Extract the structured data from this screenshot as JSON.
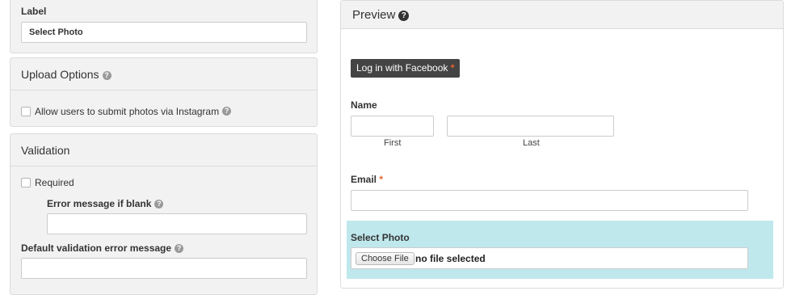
{
  "left": {
    "label_panel": {
      "label": "Label",
      "value": "Select Photo"
    },
    "upload_panel": {
      "title": "Upload Options",
      "instagram_checkbox_label": "Allow users to submit photos via Instagram",
      "instagram_checked": false
    },
    "validation_panel": {
      "title": "Validation",
      "required_label": "Required",
      "required_checked": false,
      "error_blank_label": "Error message if blank",
      "error_blank_value": "",
      "default_error_label": "Default validation error message",
      "default_error_value": ""
    }
  },
  "preview": {
    "title": "Preview",
    "facebook_button": "Log in with Facebook",
    "required_marker": "*",
    "name_label": "Name",
    "first_sublabel": "First",
    "last_sublabel": "Last",
    "email_label": "Email",
    "photo_label": "Select Photo",
    "choose_file_button": "Choose File",
    "file_status": "no file selected"
  },
  "icons": {
    "help": "question-circle-icon"
  },
  "colors": {
    "required_star": "#e8642c",
    "photo_highlight": "#bfe8ed",
    "facebook_button_bg": "#444444"
  }
}
